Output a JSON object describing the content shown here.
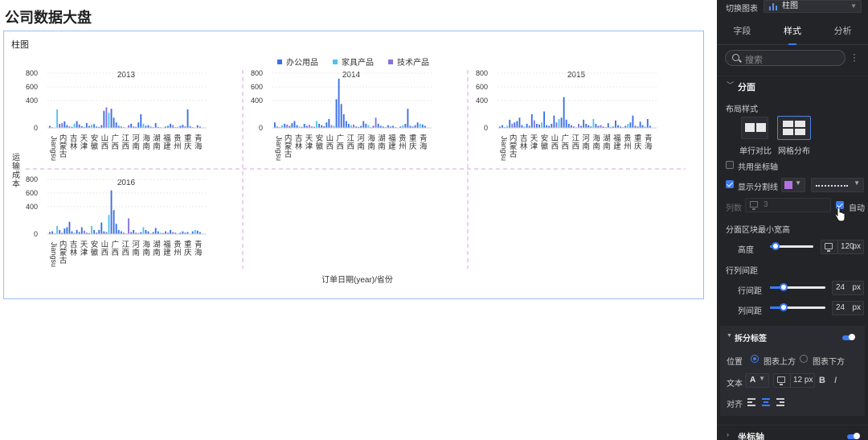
{
  "page_title": "公司数据大盘",
  "card_title": "柱图",
  "legend": [
    {
      "label": "办公用品",
      "color": "#3b6fe6"
    },
    {
      "label": "家具产品",
      "color": "#4fc3e9"
    },
    {
      "label": "技术产品",
      "color": "#8a6fe0"
    }
  ],
  "axis": {
    "ylabel": "运输成本",
    "xlabel": "订单日期(year)/省份"
  },
  "chart_data": {
    "type": "bar",
    "facets": [
      "2013",
      "2014",
      "2015",
      "2016"
    ],
    "yticks": [
      0,
      200,
      400,
      600,
      800
    ],
    "ylim": [
      0,
      800
    ],
    "categories": [
      "Jiangsu",
      "内蒙古",
      "吉林",
      "天津",
      "安徽",
      "山西",
      "广西",
      "江西",
      "河南",
      "海南",
      "湖南",
      "福建",
      "贵州",
      "重庆",
      "青海"
    ],
    "series_by_facet": [
      [
        30,
        10,
        5,
        270,
        60,
        70,
        95,
        40,
        20,
        15,
        60,
        100,
        50,
        25,
        15,
        70,
        30,
        45,
        55,
        20,
        15,
        40,
        250,
        300,
        220,
        280,
        150,
        80,
        30,
        20,
        10,
        5,
        40,
        60,
        20,
        15,
        80,
        200,
        60,
        30,
        40,
        20,
        10,
        70,
        15,
        10,
        5,
        20,
        30,
        60,
        40,
        10,
        15,
        30,
        45,
        20,
        270,
        25,
        10,
        5,
        40,
        20
      ],
      [
        80,
        20,
        10,
        40,
        60,
        50,
        30,
        70,
        100,
        40,
        20,
        15,
        60,
        30,
        45,
        20,
        15,
        100,
        60,
        40,
        25,
        80,
        130,
        40,
        30,
        420,
        720,
        350,
        200,
        100,
        60,
        40,
        50,
        20,
        15,
        30,
        100,
        60,
        40,
        10,
        30,
        150,
        60,
        30,
        20,
        15,
        40,
        20,
        30,
        10,
        5,
        20,
        40,
        60,
        280,
        30,
        20,
        40,
        80,
        60,
        50,
        30
      ],
      [
        20,
        40,
        10,
        30,
        120,
        60,
        80,
        100,
        150,
        40,
        20,
        60,
        30,
        200,
        110,
        60,
        50,
        80,
        240,
        40,
        30,
        60,
        180,
        80,
        130,
        150,
        450,
        120,
        60,
        40,
        20,
        10,
        60,
        30,
        120,
        60,
        40,
        20,
        130,
        60,
        30,
        40,
        20,
        10,
        70,
        15,
        20,
        110,
        40,
        20,
        10,
        30,
        60,
        80,
        180,
        30,
        20,
        90,
        40,
        20,
        130,
        30
      ],
      [
        30,
        40,
        10,
        120,
        60,
        20,
        80,
        100,
        180,
        40,
        20,
        60,
        30,
        100,
        50,
        20,
        15,
        120,
        60,
        20,
        60,
        170,
        40,
        30,
        280,
        640,
        350,
        150,
        60,
        40,
        20,
        10,
        230,
        30,
        60,
        20,
        15,
        30,
        100,
        60,
        40,
        10,
        30,
        90,
        40,
        20,
        15,
        40,
        20,
        60,
        30,
        20,
        10,
        20,
        40,
        20,
        30,
        5,
        40,
        60,
        50,
        30
      ]
    ]
  },
  "panel": {
    "switch_label": "切换图表",
    "chart_type": "柱图",
    "tabs": [
      "字段",
      "样式",
      "分析"
    ],
    "active_tab": "样式",
    "search_placeholder": "搜索",
    "section_title": "分面",
    "layout_style_label": "布局样式",
    "layout_options": [
      "单行对比",
      "网格分布"
    ],
    "shared_axis_label": "共用坐标轴",
    "show_divider_label": "显示分割线",
    "divider_color": "#b273e0",
    "columns_label": "列数",
    "columns_value": "3",
    "auto_label": "自动",
    "min_block_label": "分面区块最小宽高",
    "height_label": "高度",
    "height_value": "120",
    "height_unit": "px",
    "row_col_gap_label": "行列间距",
    "row_gap_label": "行间距",
    "row_gap_value": "24",
    "row_gap_unit": "px",
    "col_gap_label": "列间距",
    "col_gap_value": "24",
    "col_gap_unit": "px",
    "split_label_title": "拆分标签",
    "position_label": "位置",
    "position_above": "图表上方",
    "position_below": "图表下方",
    "text_label": "文本",
    "text_font": "A",
    "text_size": "12 px",
    "bold": "B",
    "italic": "I",
    "align_label": "对齐",
    "axis_section_title": "坐标轴"
  }
}
